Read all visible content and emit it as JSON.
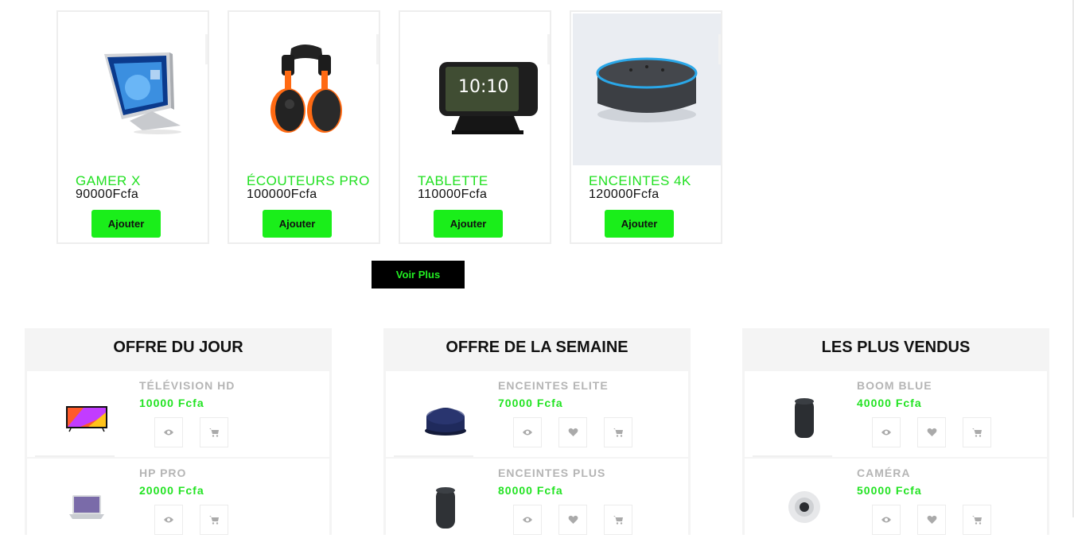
{
  "products": [
    {
      "name": "GAMER X",
      "price": "90000Fcfa",
      "button": "Ajouter",
      "image_icon": "tablet-laptop-image"
    },
    {
      "name": "ÉCOUTEURS PRO",
      "price": "100000Fcfa",
      "button": "Ajouter",
      "image_icon": "ear-defenders-image"
    },
    {
      "name": "TABLETTE",
      "price": "110000Fcfa",
      "button": "Ajouter",
      "image_icon": "smart-display-image",
      "screen_time": "10:10"
    },
    {
      "name": "ENCEINTES 4K",
      "price": "120000Fcfa",
      "button": "Ajouter",
      "image_icon": "smart-speaker-image"
    }
  ],
  "voir_plus": "Voir Plus",
  "offers": [
    {
      "title": "OFFRE DU JOUR",
      "items": [
        {
          "name": "TÉLÉVISION HD",
          "price": "10000 Fcfa",
          "image_icon": "tv-image"
        },
        {
          "name": "HP PRO",
          "price": "20000 Fcfa",
          "image_icon": "laptop-image"
        }
      ]
    },
    {
      "title": "OFFRE DE LA SEMAINE",
      "items": [
        {
          "name": "ENCEINTES ELITE",
          "price": "70000 Fcfa",
          "image_icon": "wireless-charger-image"
        },
        {
          "name": "ENCEINTES PLUS",
          "price": "80000 Fcfa",
          "image_icon": "cylinder-speaker-image"
        }
      ]
    },
    {
      "title": "LES PLUS VENDUS",
      "items": [
        {
          "name": "BOOM BLUE",
          "price": "40000 Fcfa",
          "image_icon": "cylinder-speaker-image"
        },
        {
          "name": "CAMÉRA",
          "price": "50000 Fcfa",
          "image_icon": "security-camera-image"
        }
      ]
    }
  ],
  "action_icons": [
    "eye-icon",
    "heart-icon",
    "cart-icon"
  ],
  "colors": {
    "accent_green": "#1aee1a",
    "price_green": "#22e322",
    "muted_name": "#b5b5b5",
    "panel_bg": "#f4f4f4",
    "dark_button": "#000000"
  }
}
